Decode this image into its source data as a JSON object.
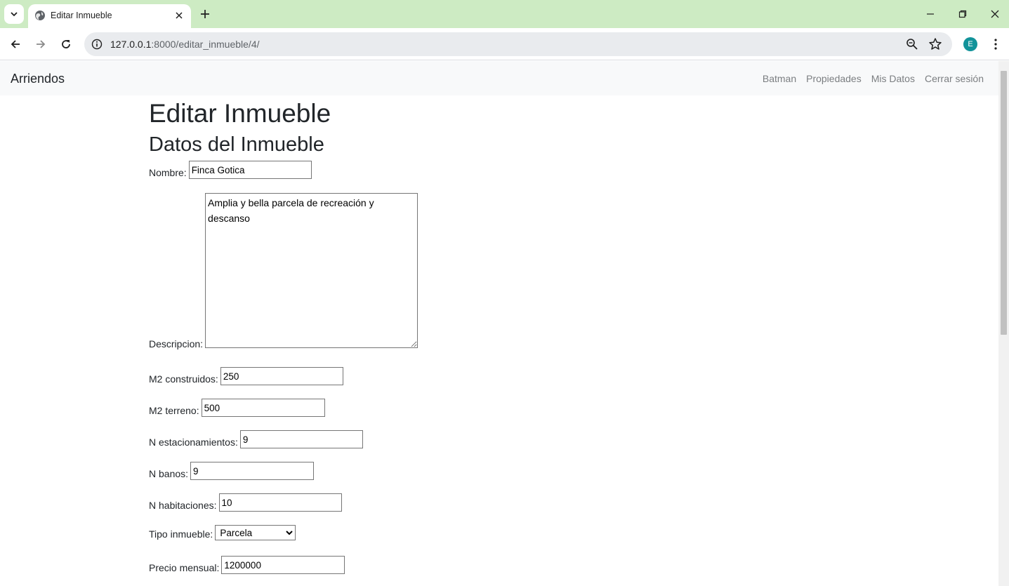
{
  "browser": {
    "tab_title": "Editar Inmueble",
    "url_host": "127.0.0.1",
    "url_path": ":8000/editar_inmueble/4/",
    "profile_initial": "E",
    "accent_color": "#cdebc3"
  },
  "navbar": {
    "brand": "Arriendos",
    "links": [
      "Batman",
      "Propiedades",
      "Mis Datos",
      "Cerrar sesión"
    ]
  },
  "page": {
    "title": "Editar Inmueble",
    "section_title": "Datos del Inmueble"
  },
  "form": {
    "nombre_label": "Nombre:",
    "nombre_value": "Finca Gotica",
    "descripcion_label": "Descripcion:",
    "descripcion_value": "Amplia y bella parcela de recreación y descanso",
    "m2_construidos_label": "M2 construidos:",
    "m2_construidos_value": "250",
    "m2_terreno_label": "M2 terreno:",
    "m2_terreno_value": "500",
    "estacionamientos_label": "N estacionamientos:",
    "estacionamientos_value": "9",
    "banos_label": "N banos:",
    "banos_value": "9",
    "habitaciones_label": "N habitaciones:",
    "habitaciones_value": "10",
    "tipo_label": "Tipo inmueble:",
    "tipo_value": "Parcela",
    "precio_label": "Precio mensual:",
    "precio_value": "1200000"
  }
}
